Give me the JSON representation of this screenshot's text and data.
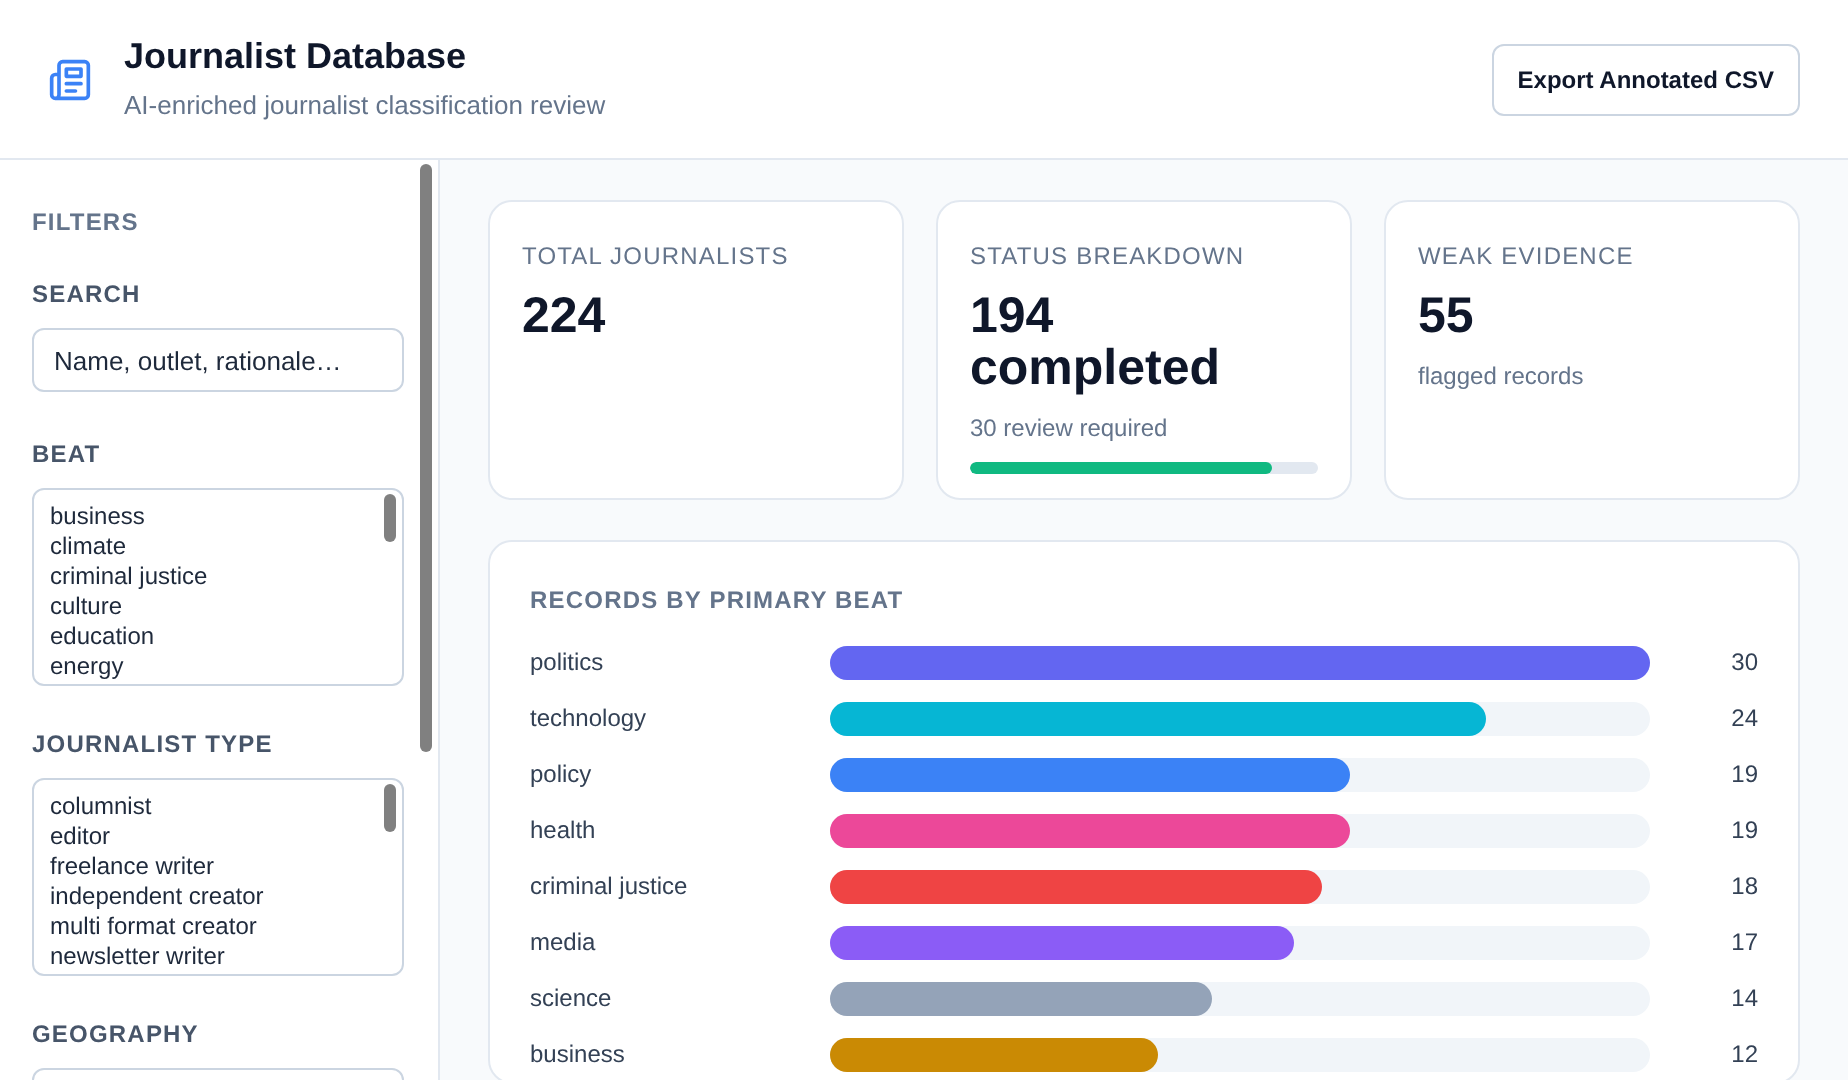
{
  "header": {
    "title": "Journalist Database",
    "subtitle": "AI-enriched journalist classification review",
    "export_button": "Export Annotated CSV"
  },
  "filters": {
    "heading": "FILTERS",
    "search": {
      "label": "SEARCH",
      "placeholder": "Name, outlet, rationale…"
    },
    "lists": [
      {
        "label": "BEAT",
        "options": [
          "business",
          "climate",
          "criminal justice",
          "culture",
          "education",
          "energy"
        ]
      },
      {
        "label": "JOURNALIST TYPE",
        "options": [
          "columnist",
          "editor",
          "freelance writer",
          "independent creator",
          "multi format creator",
          "newsletter writer"
        ]
      },
      {
        "label": "GEOGRAPHY"
      }
    ]
  },
  "stats": [
    {
      "kind": "plain",
      "label": "TOTAL JOURNALISTS",
      "value": "224"
    },
    {
      "kind": "progress",
      "label": "STATUS BREAKDOWN",
      "value": "194 completed",
      "note": "30 review required",
      "level": 0.87
    },
    {
      "kind": "note",
      "label": "WEAK EVIDENCE",
      "value": "55",
      "note": "flagged records"
    }
  ],
  "beat_chart": {
    "title": "RECORDS BY PRIMARY BEAT",
    "rows": [
      {
        "beat": "politics",
        "count": "30",
        "level": 1.0,
        "color": "#6366f1"
      },
      {
        "beat": "technology",
        "count": "24",
        "level": 0.8,
        "color": "#06b6d4"
      },
      {
        "beat": "policy",
        "count": "19",
        "level": 0.633,
        "color": "#3b82f6"
      },
      {
        "beat": "health",
        "count": "19",
        "level": 0.633,
        "color": "#ec4899"
      },
      {
        "beat": "criminal justice",
        "count": "18",
        "level": 0.6,
        "color": "#ef4444"
      },
      {
        "beat": "media",
        "count": "17",
        "level": 0.567,
        "color": "#8b5cf6"
      },
      {
        "beat": "science",
        "count": "14",
        "level": 0.467,
        "color": "#94a3b8"
      },
      {
        "beat": "business",
        "count": "12",
        "level": 0.4,
        "color": "#ca8a04"
      }
    ]
  }
}
